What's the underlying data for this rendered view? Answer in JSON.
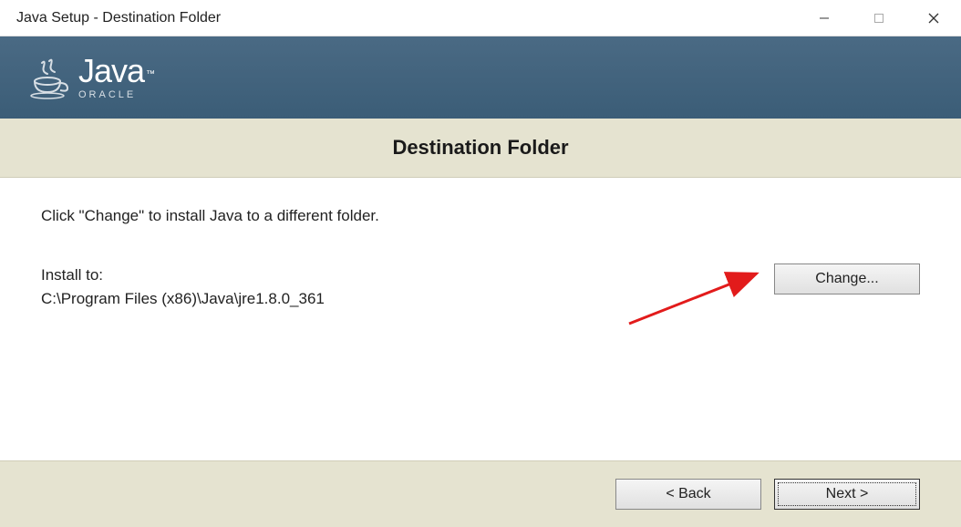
{
  "titlebar": {
    "title": "Java Setup - Destination Folder"
  },
  "banner": {
    "logo_text": "Java",
    "logo_tm": "™",
    "oracle_text": "ORACLE"
  },
  "header": {
    "title": "Destination Folder"
  },
  "content": {
    "instruction": "Click \"Change\" to install Java to a different folder.",
    "install_to_label": "Install to:",
    "install_path": "C:\\Program Files (x86)\\Java\\jre1.8.0_361",
    "change_button": "Change..."
  },
  "footer": {
    "back_button": "< Back",
    "next_button": "Next >"
  }
}
